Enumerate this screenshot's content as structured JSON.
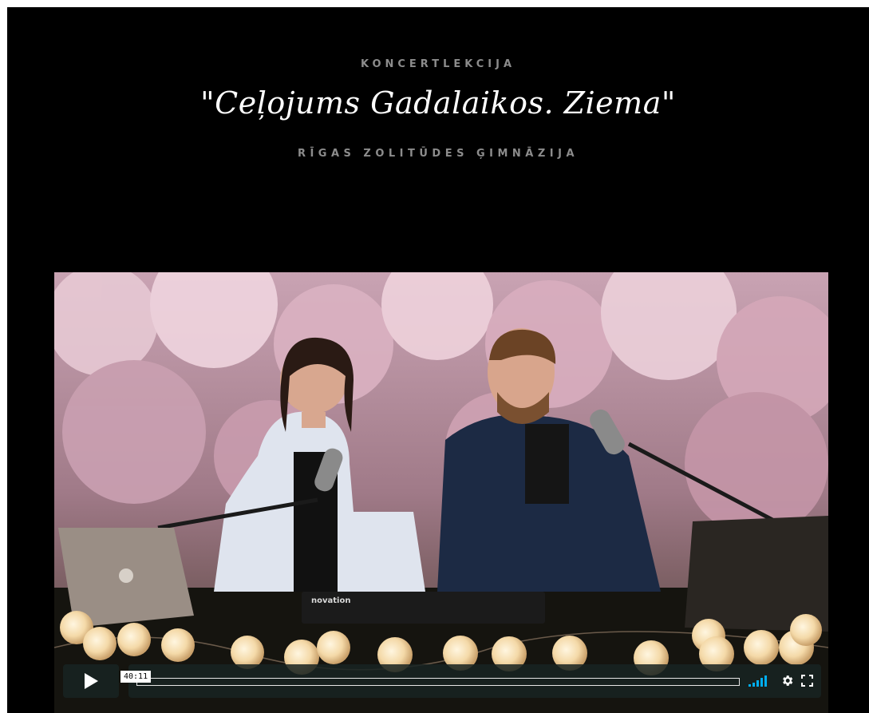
{
  "header": {
    "eyebrow": "KONCERTLEKCIJA",
    "title": "\"Ceļojums Gadalaikos. Ziema\"",
    "subtitle": "RĪGAS ZOLITŪDES ĢIMNĀZIJA"
  },
  "player": {
    "time_display": "40:11",
    "progress": 0,
    "icons": {
      "play": "play-icon",
      "volume": "volume-icon",
      "settings": "gear-icon",
      "fullscreen": "fullscreen-icon"
    },
    "keyboard_label": "novation"
  },
  "colors": {
    "page_background": "#000000",
    "heading_gray": "#8c8c8c",
    "title_white": "#ffffff",
    "control_background": "#172322",
    "volume_accent": "#00adef"
  }
}
